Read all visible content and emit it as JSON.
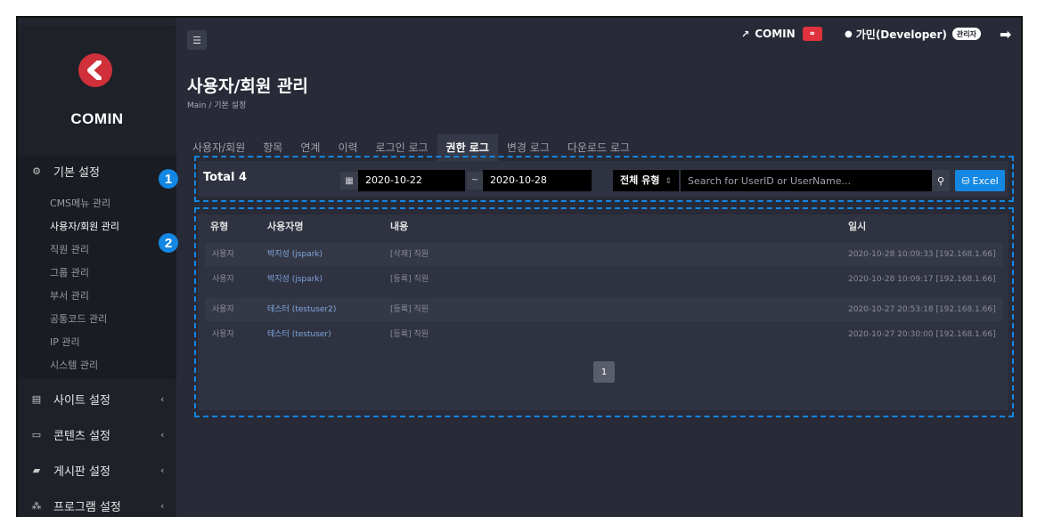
{
  "sidebar": {
    "logo_text": "COMIN",
    "menus": [
      {
        "label": "기본 설정",
        "icon": "gear-icon"
      },
      {
        "label": "사이트 설정",
        "icon": "server-icon"
      },
      {
        "label": "콘텐츠 설정",
        "icon": "content-icon"
      },
      {
        "label": "게시판 설정",
        "icon": "chat-icon"
      },
      {
        "label": "프로그램 설정",
        "icon": "network-icon"
      }
    ],
    "subitems": [
      "CMS메뉴 관리",
      "사용자/회원 관리",
      "직원 관리",
      "그룹 관리",
      "부서 관리",
      "공통코드 관리",
      "IP 관리",
      "시스템 관리"
    ],
    "active_subitem": "사용자/회원 관리"
  },
  "header": {
    "site_label": "COMIN",
    "user_label": "가민(Developer)",
    "role_badge": "관리자"
  },
  "page": {
    "title": "사용자/회원 관리",
    "breadcrumb": "Main / 기본 설정"
  },
  "tabs": [
    "사용자/회원",
    "항목",
    "연계",
    "이력",
    "로그인 로그",
    "권한 로그",
    "변경 로그",
    "다운로드 로그"
  ],
  "active_tab": "권한 로그",
  "annotations": [
    "1",
    "2"
  ],
  "filter": {
    "total": "Total 4",
    "date_from": "2020-10-22",
    "date_sep": "~",
    "date_to": "2020-10-28",
    "type_select": "전체 유형",
    "search_placeholder": "Search for UserID or UserName...",
    "excel_label": "Excel"
  },
  "table": {
    "headers": [
      "유형",
      "사용자명",
      "내용",
      "일시"
    ],
    "rows": [
      [
        "사용자",
        "박지성 (jspark)",
        "[삭제] 직원",
        "2020-10-28 10:09:33 [192.168.1.66]"
      ],
      [
        "사용자",
        "박지성 (jspark)",
        "[등록] 직원",
        "2020-10-28 10:09:17 [192.168.1.66]"
      ],
      [
        "사용자",
        "테스터 (testuser2)",
        "[등록] 직원",
        "2020-10-27 20:53:18 [192.168.1.66]"
      ],
      [
        "사용자",
        "테스터 (testuser)",
        "[등록] 직원",
        "2020-10-27 20:30:00 [192.168.1.66]"
      ]
    ]
  },
  "pagination": {
    "current": "1"
  },
  "colors": {
    "accent": "#1287e3",
    "brand": "#d0303a",
    "background": "#282b37",
    "sidebar": "#1f2129"
  }
}
